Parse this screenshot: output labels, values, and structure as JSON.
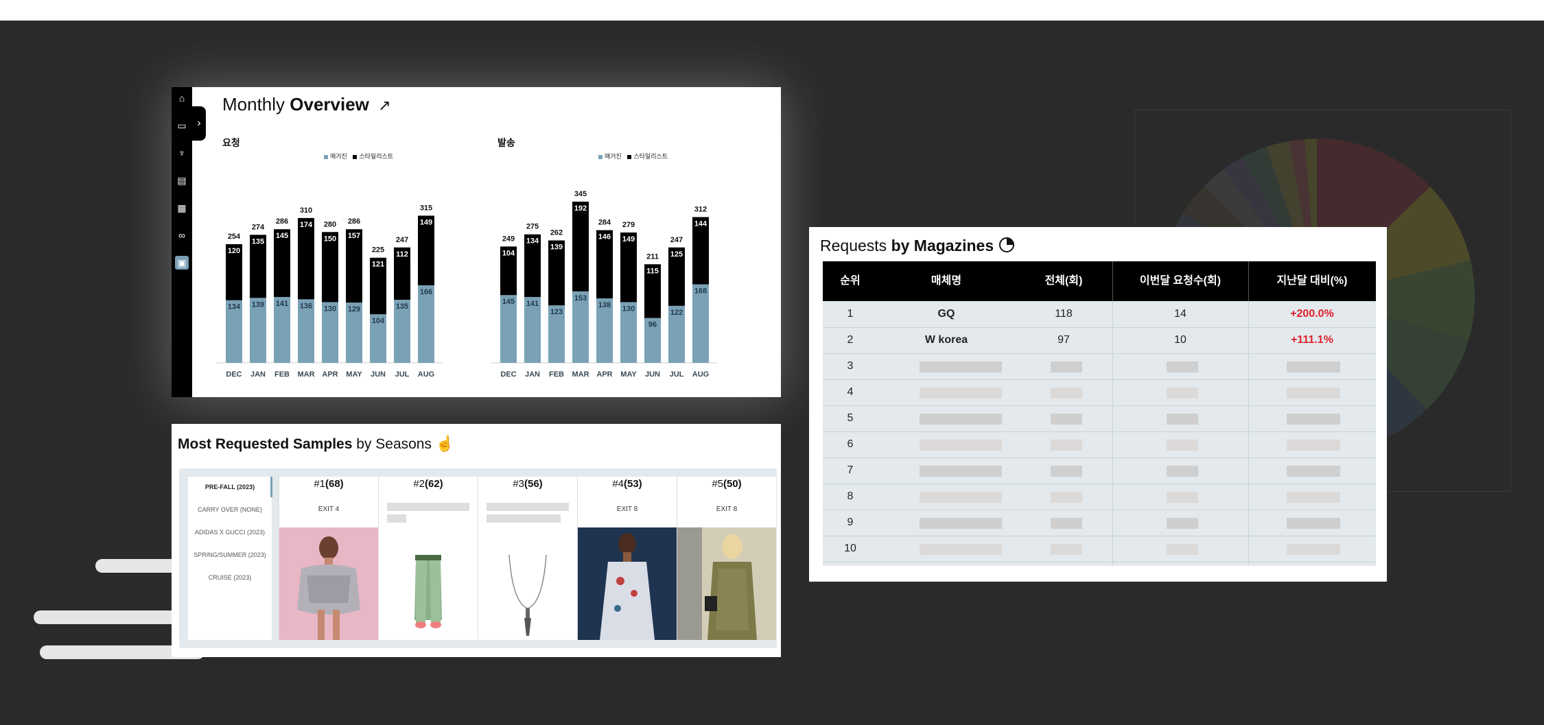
{
  "overview": {
    "title_light": "Monthly",
    "title_bold": "Overview",
    "trend_icon": "trend-up-icon",
    "sidebar_icons": [
      "home-icon",
      "monitor-icon",
      "shirt-icon",
      "clipboard-icon",
      "calendar-icon",
      "link-icon",
      "dashboard-icon"
    ],
    "expand_glyph": "›",
    "legend_magazine": "매거진",
    "legend_stylist": "스타일리스트",
    "colors": {
      "magazine": "#7aa1b6",
      "stylist": "#000000"
    }
  },
  "chart_data": [
    {
      "type": "bar",
      "stacked": true,
      "title": "요청",
      "categories": [
        "DEC",
        "JAN",
        "FEB",
        "MAR",
        "APR",
        "MAY",
        "JUN",
        "JUL",
        "AUG"
      ],
      "series": [
        {
          "name": "매거진",
          "color": "#7aa1b6",
          "values": [
            134,
            139,
            141,
            136,
            130,
            129,
            104,
            135,
            166
          ]
        },
        {
          "name": "스타일리스트",
          "color": "#000000",
          "values": [
            120,
            135,
            145,
            174,
            150,
            157,
            121,
            112,
            149
          ]
        }
      ],
      "totals": [
        254,
        274,
        286,
        310,
        280,
        286,
        225,
        247,
        315
      ],
      "legend": "top-center",
      "ylim": [
        0,
        345
      ]
    },
    {
      "type": "bar",
      "stacked": true,
      "title": "발송",
      "categories": [
        "DEC",
        "JAN",
        "FEB",
        "MAR",
        "APR",
        "MAY",
        "JUN",
        "JUL",
        "AUG"
      ],
      "series": [
        {
          "name": "매거진",
          "color": "#7aa1b6",
          "values": [
            145,
            141,
            123,
            153,
            138,
            130,
            96,
            122,
            168
          ]
        },
        {
          "name": "스타일리스트",
          "color": "#000000",
          "values": [
            104,
            134,
            139,
            192,
            146,
            149,
            115,
            125,
            144
          ]
        }
      ],
      "totals": [
        249,
        275,
        262,
        345,
        284,
        279,
        211,
        247,
        312
      ],
      "legend": "top-center",
      "ylim": [
        0,
        345
      ]
    }
  ],
  "samples": {
    "title_bold": "Most Requested Samples",
    "title_light": "by Seasons",
    "title_icon": "hand-pointer-icon",
    "seasons": [
      "PRE-FALL (2023)",
      "CARRY OVER (NONE)",
      "ADIDAS X GUCCI (2023)",
      "SPRING/SUMMER (2023)",
      "CRUISE (2023)"
    ],
    "active_season": "PRE-FALL (2023)",
    "ranks": [
      {
        "rank": "#1",
        "count": "(68)",
        "exit": "EXIT 4",
        "image": "sequin-dress-photo"
      },
      {
        "rank": "#2",
        "count": "(62)",
        "exit": "",
        "image": "green-tights-photo"
      },
      {
        "rank": "#3",
        "count": "(56)",
        "exit": "",
        "image": "necklace-photo"
      },
      {
        "rank": "#4",
        "count": "(53)",
        "exit": "EXIT 8",
        "image": "floral-dress-photo"
      },
      {
        "rank": "#5",
        "count": "(50)",
        "exit": "EXIT 8",
        "image": "plaid-coat-photo"
      }
    ]
  },
  "magazines": {
    "title_light": "Requests",
    "title_bold": "by Magazines",
    "title_icon": "pie-chart-icon",
    "headers": [
      "순위",
      "매체명",
      "전체(회)",
      "이번달 요청수(회)",
      "지난달 대비(%)"
    ],
    "rows": [
      {
        "rank": "1",
        "name": "GQ",
        "total": "118",
        "this_month": "14",
        "change": "+200.0%"
      },
      {
        "rank": "2",
        "name": "W korea",
        "total": "97",
        "this_month": "10",
        "change": "+111.1%"
      },
      {
        "rank": "3"
      },
      {
        "rank": "4"
      },
      {
        "rank": "5"
      },
      {
        "rank": "6"
      },
      {
        "rank": "7"
      },
      {
        "rank": "8"
      },
      {
        "rank": "9"
      },
      {
        "rank": "10"
      }
    ],
    "change_color": "#e0202a"
  }
}
